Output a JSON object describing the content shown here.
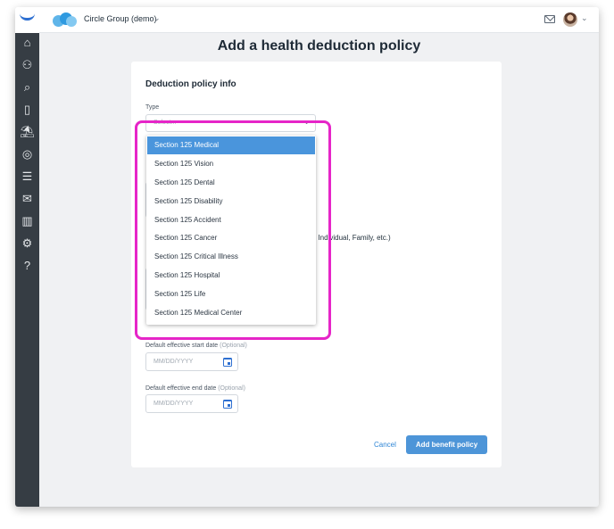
{
  "topbar": {
    "company_name": "Circle Group (demo)",
    "company_chevron": "⌄",
    "user_chevron": "⌄"
  },
  "sidebar": {
    "icons": [
      "home-icon",
      "people-icon",
      "person-search-icon",
      "clipboard-icon",
      "beach-icon",
      "camera-icon",
      "documents-icon",
      "certificate-icon",
      "bar-chart-icon",
      "gear-icon",
      "help-icon"
    ],
    "glyphs": [
      "⌂",
      "⚇",
      "⌕",
      "▯",
      "⛱",
      "◎",
      "☰",
      "✉",
      "▥",
      "⚙",
      "?"
    ]
  },
  "page": {
    "title": "Add a health deduction policy"
  },
  "form": {
    "section_title": "Deduction policy info",
    "type_label": "Type",
    "type_placeholder": "Select...",
    "type_caret": "⌄",
    "partial_text": ", Individual, Family, etc.)",
    "start_date_label": "Default effective start date",
    "start_date_optional": "(Optional)",
    "start_date_placeholder": "MM/DD/YYYY",
    "end_date_label": "Default effective end date",
    "end_date_optional": "(Optional)",
    "end_date_placeholder": "MM/DD/YYYY",
    "cancel_label": "Cancel",
    "submit_label": "Add benefit policy"
  },
  "dropdown": {
    "selected_index": 0,
    "options": [
      "Section 125 Medical",
      "Section 125 Vision",
      "Section 125 Dental",
      "Section 125 Disability",
      "Section 125 Accident",
      "Section 125 Cancer",
      "Section 125 Critical Illness",
      "Section 125 Hospital",
      "Section 125 Life",
      "Section 125 Medical Center"
    ]
  },
  "colors": {
    "accent": "#4a95dc",
    "highlight": "#e625c8",
    "sidebar": "#363d44"
  }
}
